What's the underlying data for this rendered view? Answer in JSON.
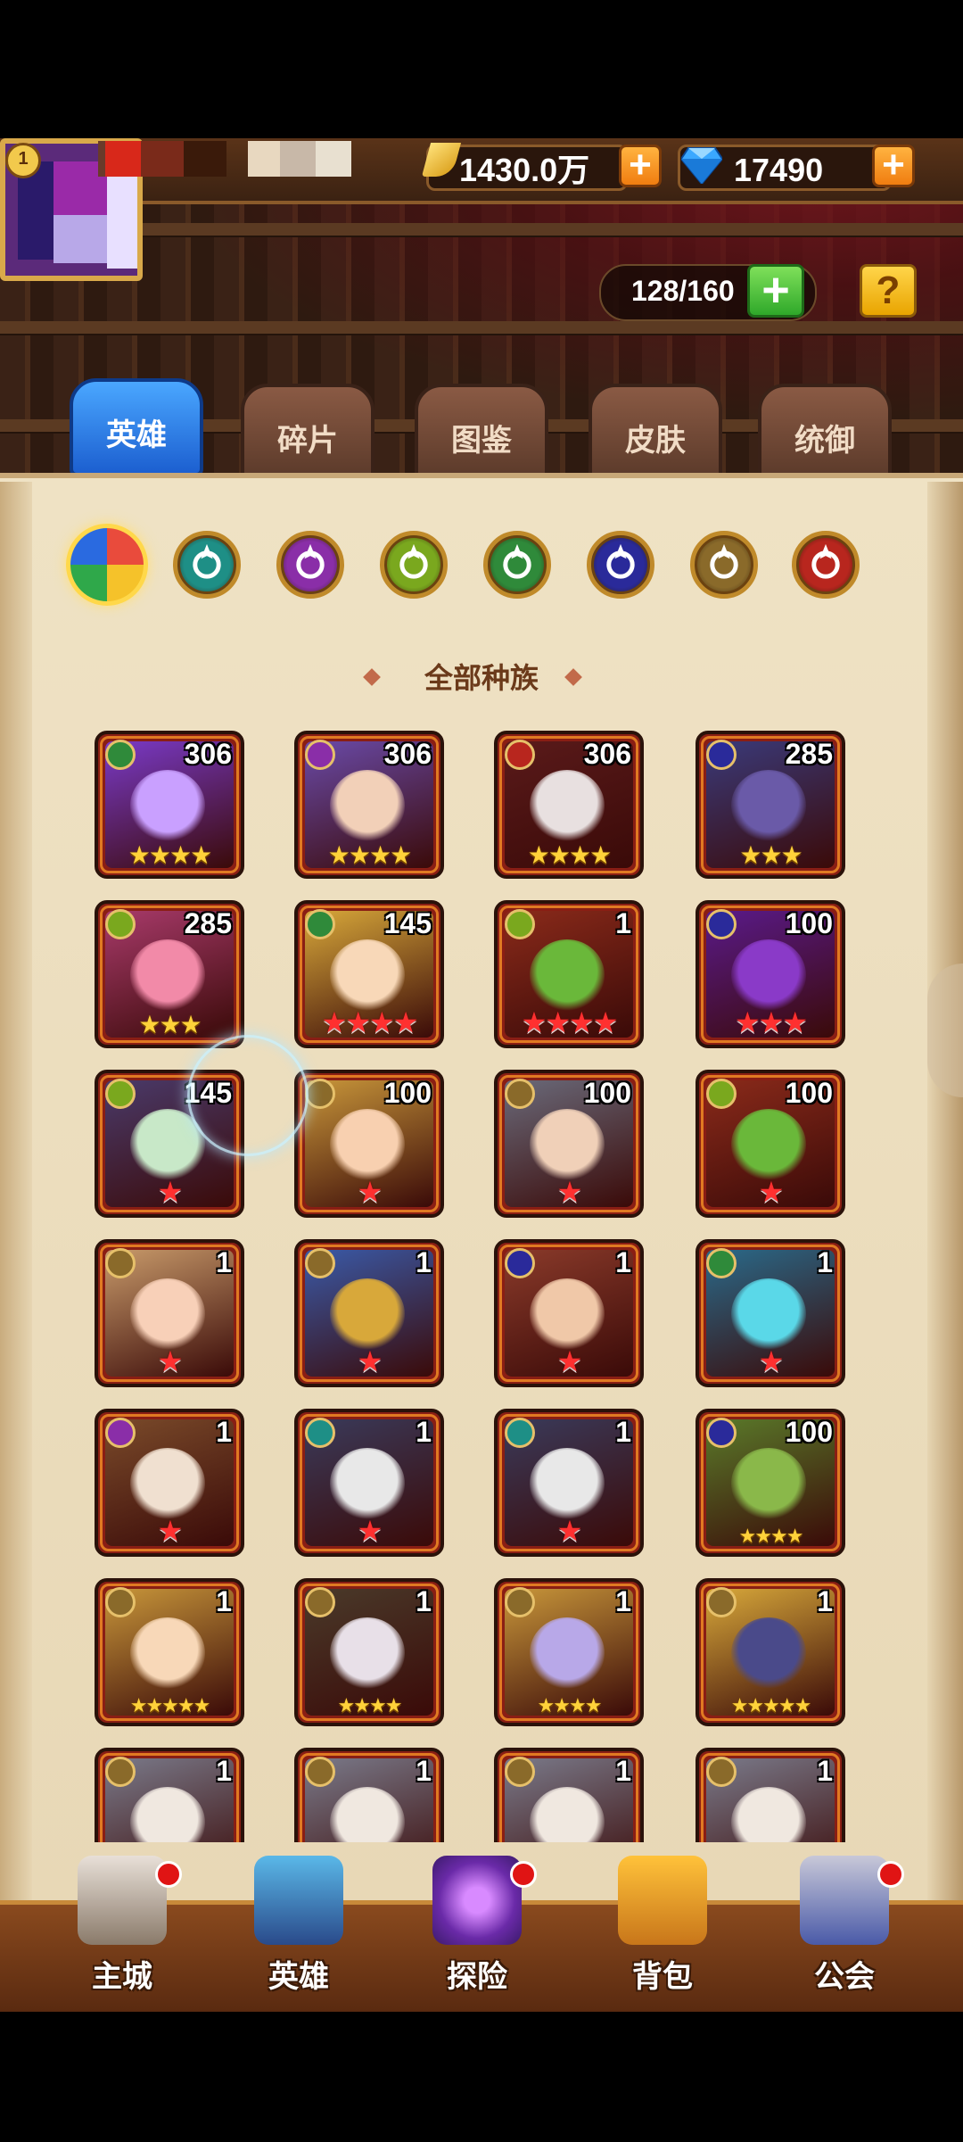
{
  "header": {
    "level": "1",
    "gold": "1430.0万",
    "gems": "17490",
    "capacity": "128/160",
    "help": "?"
  },
  "tabs": [
    {
      "label": "英雄",
      "active": true
    },
    {
      "label": "碎片",
      "active": false
    },
    {
      "label": "图鉴",
      "active": false
    },
    {
      "label": "皮肤",
      "active": false
    },
    {
      "label": "统御",
      "active": false
    }
  ],
  "factions": [
    {
      "name": "all-factions",
      "color": "#e94b3c"
    },
    {
      "name": "faction-teal",
      "color": "#1e8f86"
    },
    {
      "name": "faction-purple",
      "color": "#8a2ea8"
    },
    {
      "name": "faction-green-eye",
      "color": "#7aa81e"
    },
    {
      "name": "faction-forest",
      "color": "#2f8a3a"
    },
    {
      "name": "faction-shadow",
      "color": "#2a2a9a"
    },
    {
      "name": "faction-light",
      "color": "#8a6a2a"
    },
    {
      "name": "faction-red",
      "color": "#b8261e"
    }
  ],
  "race_title": "全部种族",
  "heroes": [
    {
      "count": "306",
      "stars": "★★★★",
      "star_type": "gold",
      "faction": 4,
      "art": "#7a3ac8",
      "face": "#c9a0ff"
    },
    {
      "count": "306",
      "stars": "★★★★",
      "star_type": "gold",
      "faction": 2,
      "art": "#6a4aa8",
      "face": "#f2d0b8"
    },
    {
      "count": "306",
      "stars": "★★★★",
      "star_type": "gold",
      "faction": 7,
      "art": "#5a1a1a",
      "face": "#e8e0e0"
    },
    {
      "count": "285",
      "stars": "★★★",
      "star_type": "gold",
      "faction": 5,
      "art": "#3a3a7a",
      "face": "#6a5aa8"
    },
    {
      "count": "285",
      "stars": "★★★",
      "star_type": "gold",
      "faction": 3,
      "art": "#a83a6a",
      "face": "#f28aa8"
    },
    {
      "count": "145",
      "stars": "★★★★",
      "star_type": "red",
      "faction": 4,
      "art": "#d8a83a",
      "face": "#f8d8b8"
    },
    {
      "count": "1",
      "stars": "★★★★",
      "star_type": "red",
      "faction": 3,
      "art": "#8a2a1a",
      "face": "#6ab83a"
    },
    {
      "count": "100",
      "stars": "★★★",
      "star_type": "red",
      "faction": 5,
      "art": "#5a1a8a",
      "face": "#8a3ac8"
    },
    {
      "count": "145",
      "stars": "★",
      "star_type": "red",
      "faction": 3,
      "art": "#4a3a6a",
      "face": "#c8e8c8"
    },
    {
      "count": "100",
      "stars": "★",
      "star_type": "red",
      "faction": 6,
      "art": "#c8963a",
      "face": "#f8d0b0"
    },
    {
      "count": "100",
      "stars": "★",
      "star_type": "red",
      "faction": 6,
      "art": "#6a6a7a",
      "face": "#f0d0b8"
    },
    {
      "count": "100",
      "stars": "★",
      "star_type": "red",
      "faction": 3,
      "art": "#8a2a1a",
      "face": "#6ab83a"
    },
    {
      "count": "1",
      "stars": "★",
      "star_type": "red",
      "faction": 6,
      "art": "#c89a6a",
      "face": "#f8d0b8"
    },
    {
      "count": "1",
      "stars": "★",
      "star_type": "red",
      "faction": 6,
      "art": "#3a5aa8",
      "face": "#d8a83a"
    },
    {
      "count": "1",
      "stars": "★",
      "star_type": "red",
      "faction": 5,
      "art": "#8a3a2a",
      "face": "#f0c8a8"
    },
    {
      "count": "1",
      "stars": "★",
      "star_type": "red",
      "faction": 4,
      "art": "#2a6a8a",
      "face": "#5ad8e8"
    },
    {
      "count": "1",
      "stars": "★",
      "star_type": "red",
      "faction": 2,
      "art": "#7a4a2a",
      "face": "#f0e0d0"
    },
    {
      "count": "1",
      "stars": "★",
      "star_type": "red",
      "faction": 1,
      "art": "#3a3a5a",
      "face": "#e8e8e8"
    },
    {
      "count": "1",
      "stars": "★",
      "star_type": "red",
      "faction": 1,
      "art": "#3a3a5a",
      "face": "#e8e8e8"
    },
    {
      "count": "100",
      "stars": "★★★★",
      "star_type": "small",
      "faction": 5,
      "art": "#5a7a2a",
      "face": "#8ab84a"
    },
    {
      "count": "1",
      "stars": "★★★★★",
      "star_type": "small",
      "faction": 6,
      "art": "#c8963a",
      "face": "#f8d8b8"
    },
    {
      "count": "1",
      "stars": "★★★★",
      "star_type": "small",
      "faction": 6,
      "art": "#4a3a2a",
      "face": "#e8e0e8"
    },
    {
      "count": "1",
      "stars": "★★★★",
      "star_type": "small",
      "faction": 6,
      "art": "#c8963a",
      "face": "#b8a8e8"
    },
    {
      "count": "1",
      "stars": "★★★★★",
      "star_type": "small",
      "faction": 6,
      "art": "#d8a83a",
      "face": "#4a4a8a"
    },
    {
      "count": "1",
      "stars": "",
      "star_type": "gold",
      "faction": 6,
      "art": "#7a7a8a",
      "face": "#f0e8e0"
    },
    {
      "count": "1",
      "stars": "",
      "star_type": "gold",
      "faction": 6,
      "art": "#7a7a8a",
      "face": "#f0e8e0"
    },
    {
      "count": "1",
      "stars": "",
      "star_type": "gold",
      "faction": 6,
      "art": "#7a7a8a",
      "face": "#f0e8e0"
    },
    {
      "count": "1",
      "stars": "",
      "star_type": "gold",
      "faction": 6,
      "art": "#7a7a8a",
      "face": "#f0e8e0"
    }
  ],
  "nav": [
    {
      "label": "主城",
      "icon": "castle-icon",
      "dot": true
    },
    {
      "label": "英雄",
      "icon": "hero-icon",
      "dot": false
    },
    {
      "label": "探险",
      "icon": "portal-icon",
      "dot": true
    },
    {
      "label": "背包",
      "icon": "backpack-icon",
      "dot": false
    },
    {
      "label": "公会",
      "icon": "guild-tower-icon",
      "dot": true
    }
  ]
}
